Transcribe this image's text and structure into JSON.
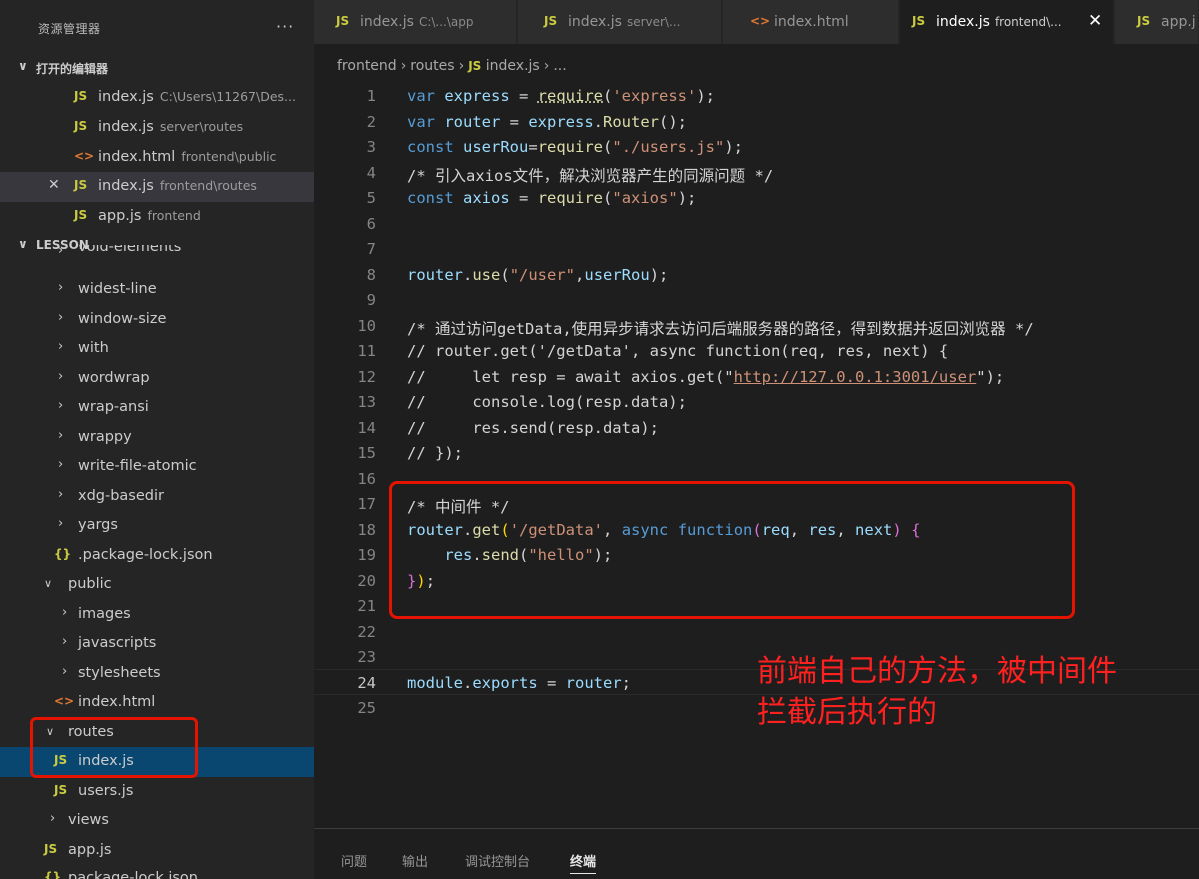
{
  "sidebar": {
    "title": "资源管理器",
    "more": "···",
    "open_editors": {
      "label": "打开的编辑器",
      "items": [
        {
          "name": "index.js",
          "desc": "C:\\Users\\11267\\Des..."
        },
        {
          "name": "index.js",
          "desc": "server\\routes"
        },
        {
          "name": "index.html",
          "desc": "frontend\\public"
        },
        {
          "name": "index.js",
          "desc": "frontend\\routes"
        },
        {
          "name": "app.js",
          "desc": "frontend"
        }
      ]
    },
    "project": {
      "label": "LESSON",
      "tree": [
        "void-elements",
        "widest-line",
        "window-size",
        "with",
        "wordwrap",
        "wrap-ansi",
        "wrappy",
        "write-file-atomic",
        "xdg-basedir",
        "yargs",
        ".package-lock.json",
        "public",
        "images",
        "javascripts",
        "stylesheets",
        "index.html",
        "routes",
        "index.js",
        "users.js",
        "views",
        "app.js",
        "package-lock.json"
      ]
    }
  },
  "tabs": [
    {
      "name": "index.js",
      "desc": "C:\\...\\app"
    },
    {
      "name": "index.js",
      "desc": "server\\..."
    },
    {
      "name": "index.html",
      "desc": ""
    },
    {
      "name": "index.js",
      "desc": "frontend\\..."
    },
    {
      "name": "app.j",
      "desc": ""
    }
  ],
  "icons": {
    "js": "JS",
    "html": "<>",
    "json": "{}",
    "close": "✕"
  },
  "breadcrumb": {
    "part1": "frontend",
    "part2": "routes",
    "part3": "index.js",
    "more": "..."
  },
  "editor": {
    "line_numbers": [
      "1",
      "2",
      "3",
      "4",
      "5",
      "6",
      "7",
      "8",
      "9",
      "10",
      "11",
      "12",
      "13",
      "14",
      "15",
      "16",
      "17",
      "18",
      "19",
      "20",
      "21",
      "22",
      "23",
      "24",
      "25"
    ],
    "current_line": "24",
    "lines": [
      "var express = require('express');",
      "var router = express.Router();",
      "const userRou=require(\"./users.js\");",
      "/* 引入axios文件，解决浏览器产生的同源问题 */",
      "const axios = require(\"axios\");",
      "",
      "",
      "router.use(\"/user\",userRou);",
      "",
      "/* 通过访问getData,使用异步请求去访问后端服务器的路径，得到数据并返回浏览器 */",
      "// router.get('/getData', async function(req, res, next) {",
      "//     let resp = await axios.get(\"http://127.0.0.1:3001/user\");",
      "//     console.log(resp.data);",
      "//     res.send(resp.data);",
      "// });",
      "",
      "/* 中间件 */",
      "router.get('/getData', async function(req, res, next) {",
      "    res.send(\"hello\");",
      "});",
      "",
      "",
      "",
      "module.exports = router;",
      ""
    ],
    "annotation_line1": "前端自己的方法，被中间件",
    "annotation_line2": "拦截后执行的"
  },
  "panel_tabs": [
    "问题",
    "输出",
    "调试控制台",
    "终端"
  ],
  "colors": {
    "accent_red": "#e51400",
    "annotation_red": "#ff2020",
    "js_yellow": "#cbcb41",
    "html_orange": "#e37933"
  }
}
